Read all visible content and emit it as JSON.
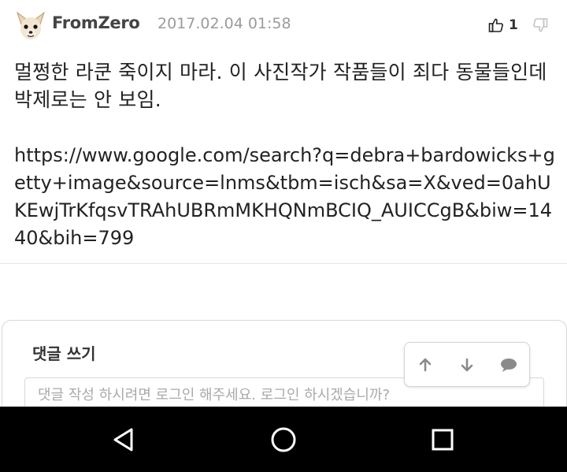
{
  "comment": {
    "username": "FromZero",
    "timestamp": "2017.02.04 01:58",
    "upvote_count": "1",
    "body": "멀쩡한 라쿤 죽이지 마라. 이 사진작가 작품들이 죄다 동물들인데 박제로는 안 보임.",
    "link": "https://www.google.com/search?q=debra+bardowicks+getty+image&source=lnms&tbm=isch&sa=X&ved=0ahUKEwjTrKfqsvTRAhUBRmMKHQNmBCIQ_AUICCgB&biw=1440&bih=799"
  },
  "write": {
    "title": "댓글 쓰기",
    "placeholder": "댓글 작성 하시려면 로그인 해주세요. 로그인 하시겠습니까?"
  },
  "icons": {
    "upvote": "thumbs-up-icon",
    "downvote": "thumbs-down-icon",
    "scroll_up": "arrow-up-icon",
    "scroll_down": "arrow-down-icon",
    "comments": "speech-bubble-icon",
    "nav_back": "triangle-back-icon",
    "nav_home": "circle-home-icon",
    "nav_recent": "square-recent-icon"
  },
  "colors": {
    "text": "#222222",
    "muted": "#9b9b9b",
    "navbar": "#000000"
  }
}
